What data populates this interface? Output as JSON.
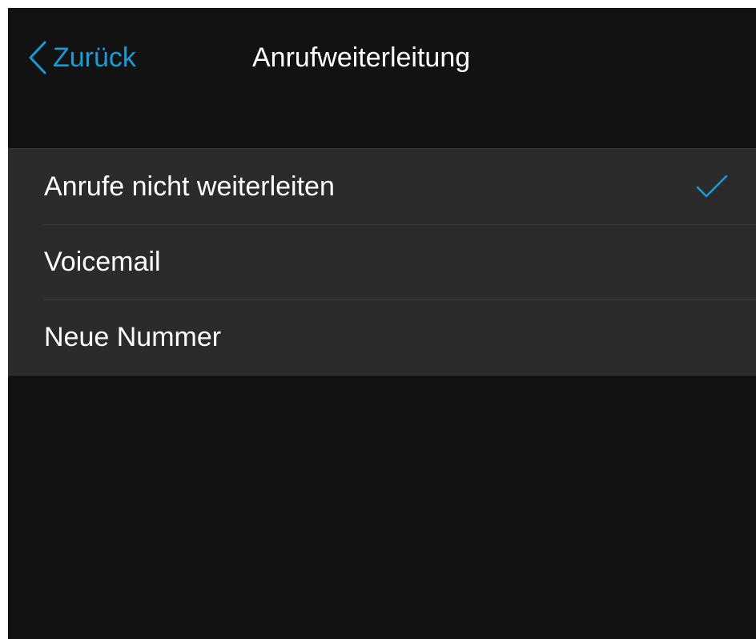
{
  "nav": {
    "back_label": "Zurück",
    "title": "Anrufweiterleitung"
  },
  "options": [
    {
      "label": "Anrufe nicht weiterleiten",
      "selected": true
    },
    {
      "label": "Voicemail",
      "selected": false
    },
    {
      "label": "Neue Nummer",
      "selected": false
    }
  ],
  "colors": {
    "accent": "#1a9bd7",
    "background": "#121212",
    "list_background": "#2b2b2b",
    "text": "#ffffff"
  },
  "icons": {
    "back": "chevron-left-icon",
    "selected": "checkmark-icon"
  }
}
